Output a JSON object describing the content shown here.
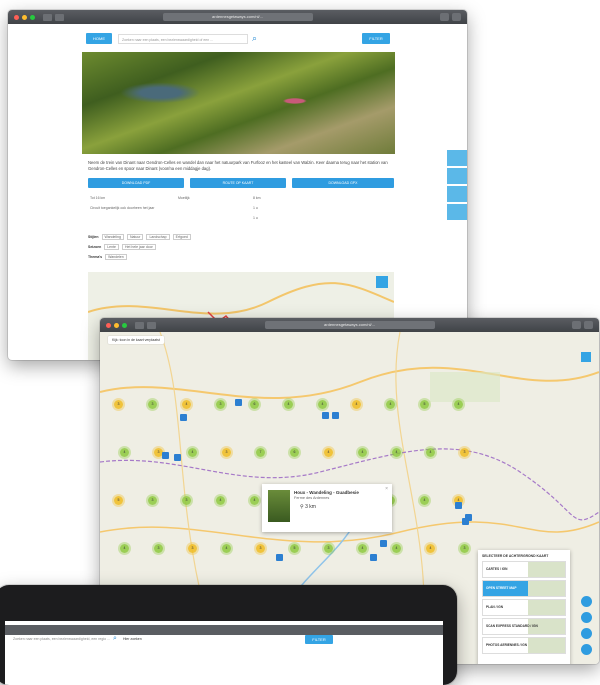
{
  "window_top": {
    "url": "ardennesgetaways.com/nl/...",
    "home_button": "HOME",
    "search_placeholder": "Zoeken naar een plaats, een bezienswaardigheid of een ...",
    "filter_button": "FILTER",
    "intro": "Neem de trein van Dinant naar Gendron-Celles en wandel dan naar het natuurpark van Furfooz en het kasteel van Walzin. Keer daarna terug naar het station van Gendron-Celles en spoor naar Dinant (voor/na een middagje dag).",
    "buttons": [
      "DOWNLOAD PDF",
      "ROUTE OP KAART",
      "DOWNLOAD GPX"
    ],
    "facts_left": [
      "Tot 16 km",
      "Circuit toegankelijk ook doorheen het jaar"
    ],
    "facts_label": "Moeilijk",
    "facts_right": [
      "8 km",
      "1 u",
      "1 u"
    ],
    "tags_label": "Stijlen",
    "tags": [
      "Wandeling",
      "Natuur",
      "Landschap",
      "Erfgoed"
    ],
    "seasons_label": "Seizoen",
    "seasons": [
      "Lente",
      "Het hele jaar door"
    ],
    "themes_label": "Thema's",
    "themes": [
      "Wandelen"
    ]
  },
  "window_map": {
    "url": "ardennesgetaways.com/nl/...",
    "checkbox_label": "Kijk: toon in de kaart verplaatst",
    "popup": {
      "title": "Houx - Wandeling - Guadbesie",
      "subtitle": "Ferme des Ardennes",
      "distance": "3 km"
    },
    "clusters": [
      "3",
      "3",
      "4",
      "3",
      "6",
      "4",
      "4",
      "4",
      "4",
      "5",
      "4",
      "4",
      "3",
      "4",
      "3",
      "7",
      "6",
      "4",
      "4",
      "4",
      "4",
      "3",
      "5",
      "3",
      "3",
      "4",
      "4",
      "3",
      "4",
      "2",
      "3",
      "4",
      "4",
      "4",
      "3",
      "3",
      "4",
      "3",
      "5",
      "3",
      "4",
      "4",
      "4",
      "3",
      "4",
      "6",
      "3",
      "3",
      "4",
      "5"
    ],
    "layers_title": "SELECTEER DE ACHTERGROND KAART",
    "layers": [
      "CARTES / IGN",
      "OPEN STREET MAP",
      "PLAN / IGN",
      "SCAN EXPRESS STANDARD / IGN",
      "PHOTOS AERIENNES / IGN"
    ],
    "active_layer": "OPEN STREET MAP"
  },
  "window_laptop": {
    "search_placeholder": "Zoeken naar een plaats, een bezienswaardigheid, een regio ...",
    "search_hint": "Hier zoeken",
    "filter_button": "FILTER"
  }
}
